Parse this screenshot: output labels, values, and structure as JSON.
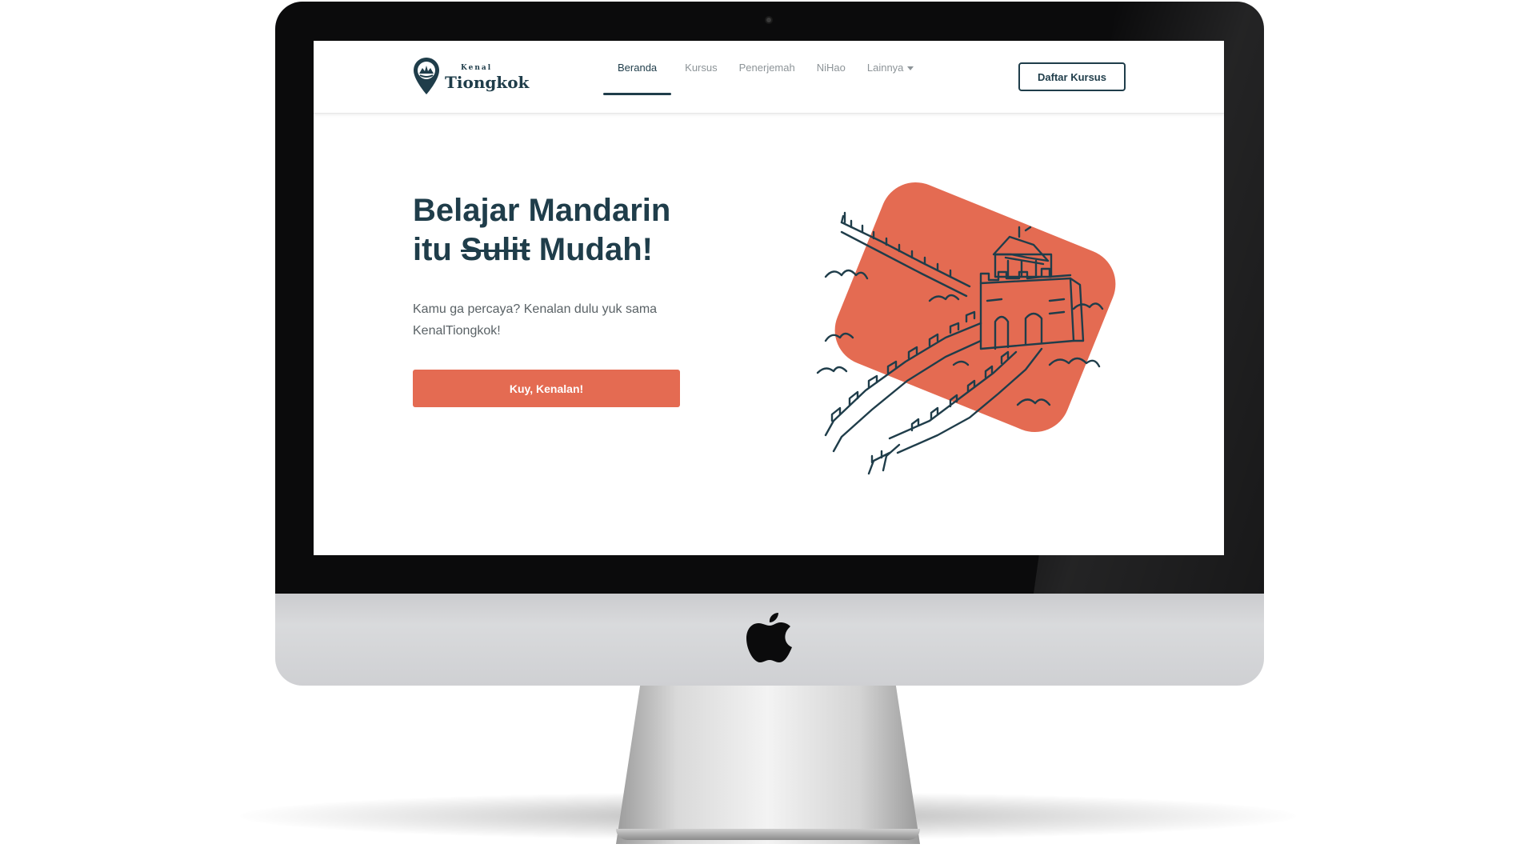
{
  "device": {
    "type": "iMac",
    "logo_icon": "apple-icon"
  },
  "site": {
    "logo": {
      "small": "Kenal",
      "big": "Tiongkok",
      "icon": "map-pin-icon"
    },
    "nav": [
      {
        "label": "Beranda",
        "active": true
      },
      {
        "label": "Kursus",
        "active": false
      },
      {
        "label": "Penerjemah",
        "active": false
      },
      {
        "label": "NiHao",
        "active": false
      },
      {
        "label": "Lainnya",
        "active": false,
        "dropdown": true
      }
    ],
    "cta_header": "Daftar Kursus",
    "hero": {
      "title_line1": "Belajar Mandarin",
      "title_word1": "itu",
      "title_strike": "Sulit",
      "title_word3": "Mudah!",
      "subtitle": "Kamu ga percaya? Kenalan dulu yuk sama KenalTiongkok!",
      "button": "Kuy, Kenalan!"
    },
    "illustration": {
      "icon": "great-wall-illustration"
    }
  },
  "colors": {
    "primary": "#1f3d4a",
    "accent": "#e46b52",
    "muted": "#8d9498",
    "text": "#5a6266"
  }
}
